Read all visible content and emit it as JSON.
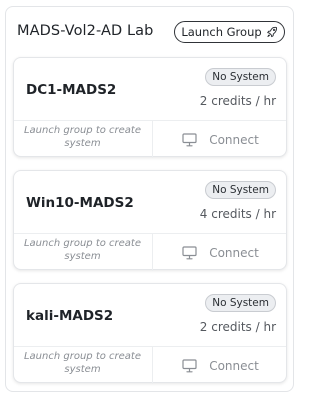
{
  "lab": {
    "title": "MADS-Vol2-AD Lab",
    "launch_label": "Launch Group"
  },
  "cards": [
    {
      "name": "DC1-MADS2",
      "status": "No System",
      "credits": "2 credits / hr",
      "hint": "Launch group to create system",
      "connect_label": "Connect"
    },
    {
      "name": "Win10-MADS2",
      "status": "No System",
      "credits": "4 credits / hr",
      "hint": "Launch group to create system",
      "connect_label": "Connect"
    },
    {
      "name": "kali-MADS2",
      "status": "No System",
      "credits": "2 credits / hr",
      "hint": "Launch group to create system",
      "connect_label": "Connect"
    }
  ],
  "icons": {
    "launch": "rocket-icon",
    "connect": "monitor-icon"
  }
}
